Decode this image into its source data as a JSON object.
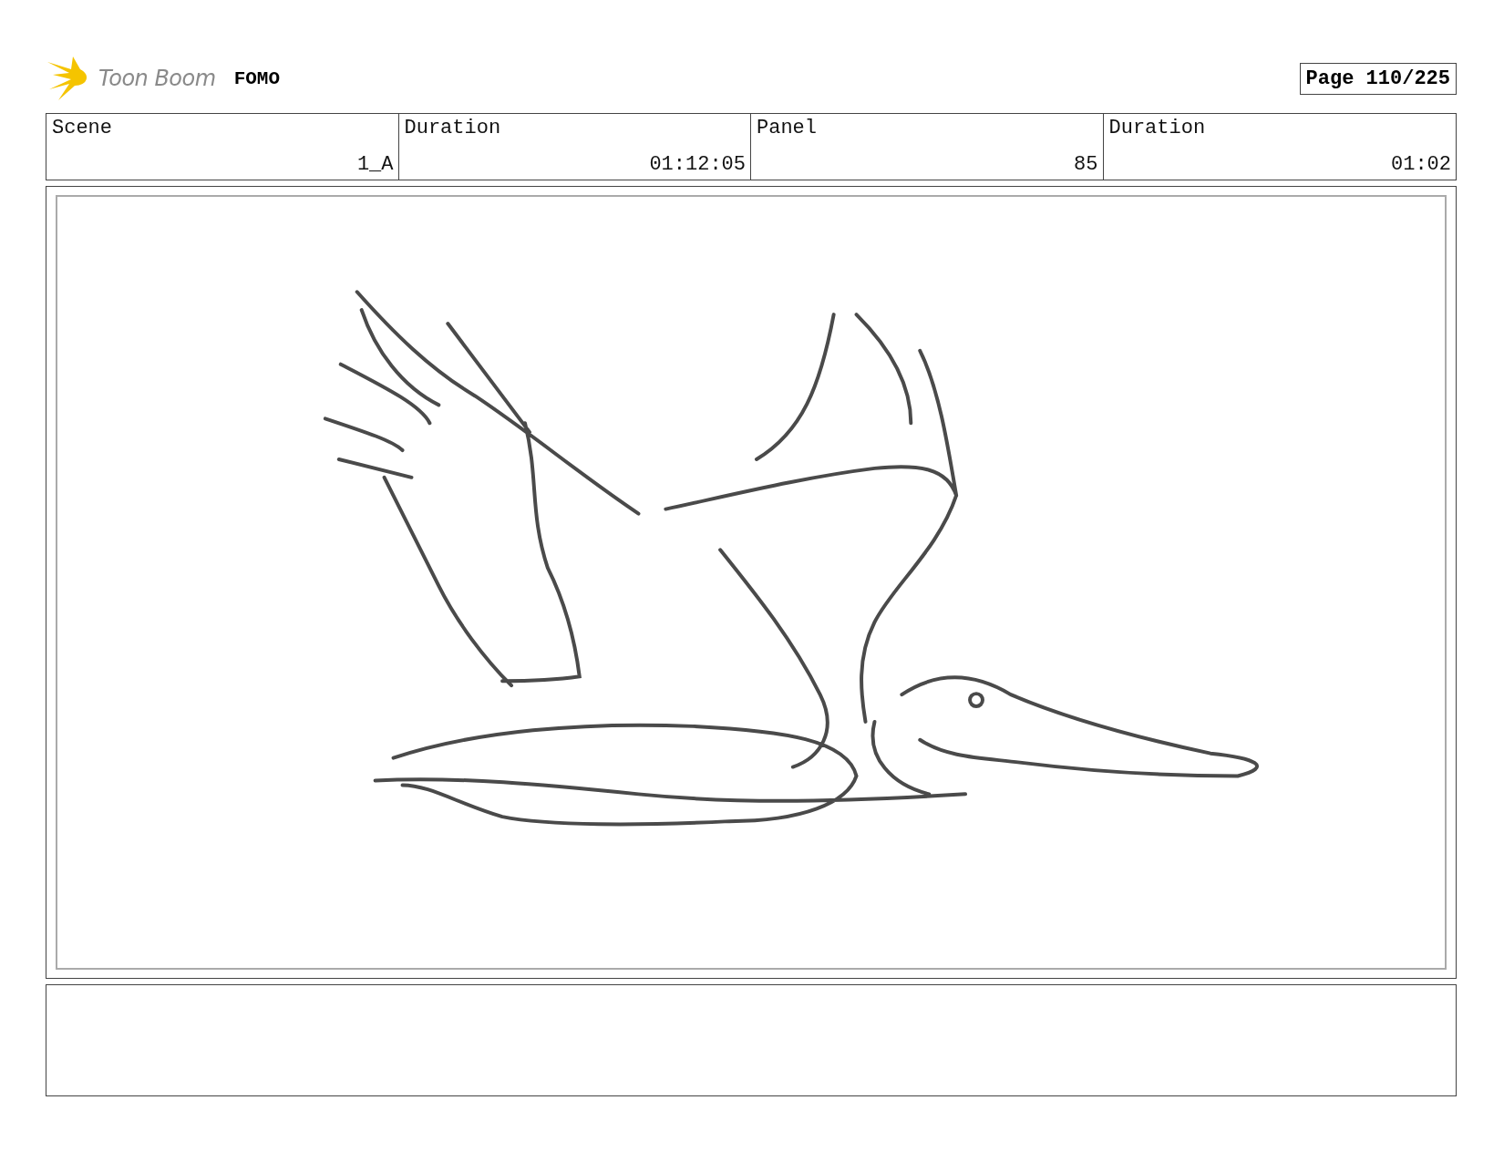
{
  "header": {
    "logo_text": "Toon Boom",
    "project": "FOMO",
    "page": "Page 110/225"
  },
  "table": {
    "columns": [
      "Scene",
      "Duration",
      "Panel",
      "Duration"
    ],
    "rows": [
      [
        "1_A",
        "01:12:05",
        "85",
        "01:02"
      ]
    ]
  }
}
